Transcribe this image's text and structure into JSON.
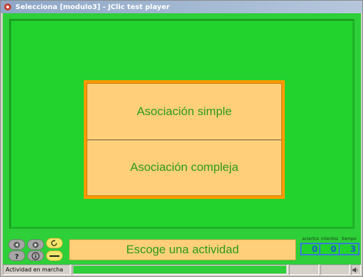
{
  "window": {
    "title": "Selecciona [modulo3] - JClic test player"
  },
  "menu": {
    "items": [
      {
        "label": "Asociación simple"
      },
      {
        "label": "Asociación compleja"
      }
    ]
  },
  "message": "Escoge una actividad",
  "counters": [
    {
      "label": "aciertos",
      "value": "0"
    },
    {
      "label": "intentos",
      "value": "0"
    },
    {
      "label": "tiempo",
      "value": "3"
    }
  ],
  "status": {
    "text": "Actividad en marcha",
    "progress": 1.0
  },
  "icons": {
    "app": "jclic-app-icon",
    "prev": "arrow-left-icon",
    "next": "arrow-right-icon",
    "reload": "reload-icon",
    "help": "help-icon",
    "info": "info-icon",
    "jclic": "jclic-logo-icon",
    "sound": "speaker-icon"
  },
  "colors": {
    "stage": "#2ecf38",
    "menu_border": "#ff9a00",
    "cell_background": "#ffd079",
    "text_green": "#2a9a1c",
    "counter_blue": "#1a5ad0"
  }
}
